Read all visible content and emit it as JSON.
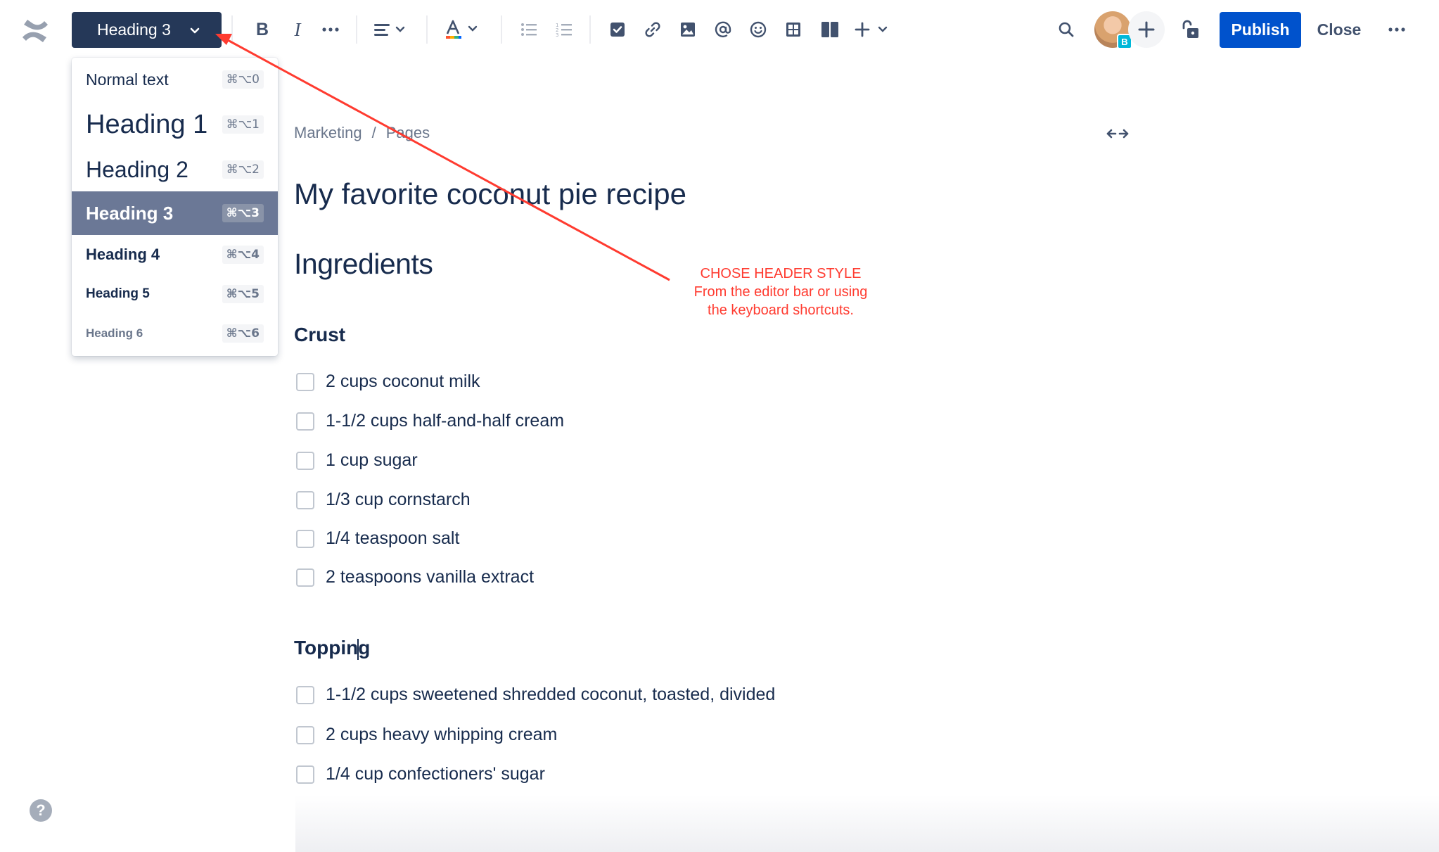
{
  "toolbar": {
    "text_style_label": "Heading 3",
    "publish_label": "Publish",
    "close_label": "Close",
    "avatar_badge": "B",
    "icons": [
      "confluence-logo-icon",
      "bold-icon",
      "italic-icon",
      "more-formatting-icon",
      "align-icon",
      "text-color-icon",
      "bullet-list-icon",
      "numbered-list-icon",
      "action-item-icon",
      "link-icon",
      "image-icon",
      "mention-icon",
      "emoji-icon",
      "table-icon",
      "layouts-icon",
      "insert-icon",
      "search-icon",
      "restrictions-icon",
      "more-icon"
    ]
  },
  "dropdown": {
    "items": [
      {
        "label": "Normal text",
        "shortcut": "⌘⌥0"
      },
      {
        "label": "Heading 1",
        "shortcut": "⌘⌥1"
      },
      {
        "label": "Heading 2",
        "shortcut": "⌘⌥2"
      },
      {
        "label": "Heading 3",
        "shortcut": "⌘⌥3"
      },
      {
        "label": "Heading 4",
        "shortcut": "⌘⌥4"
      },
      {
        "label": "Heading 5",
        "shortcut": "⌘⌥5"
      },
      {
        "label": "Heading 6",
        "shortcut": "⌘⌥6"
      }
    ],
    "selected": "Heading 3"
  },
  "page": {
    "breadcrumb": [
      "Marketing",
      "Pages"
    ],
    "title": "My favorite coconut pie recipe",
    "section_heading": "Ingredients",
    "crust_heading": "Crust",
    "crust_items": [
      "2 cups coconut milk",
      "1-1/2 cups half-and-half cream",
      "1 cup sugar",
      "1/3 cup cornstarch",
      "1/4 teaspoon salt",
      "2 teaspoons vanilla extract"
    ],
    "topping_heading_before_cursor": "Toppin",
    "topping_heading_after_cursor": "g",
    "topping_items": [
      "1-1/2 cups sweetened shredded coconut, toasted, divided",
      "2 cups heavy whipping cream",
      "1/4 cup confectioners' sugar"
    ]
  },
  "annotation": {
    "line1": "CHOSE HEADER STYLE",
    "line2": "From the editor bar or using",
    "line3": "the keyboard shortcuts.",
    "color": "#ff3b30"
  },
  "colors": {
    "primary": "#0052cc",
    "text_style_button": "#253858",
    "selected_item": "#6b7896",
    "text": "#172b4d",
    "muted": "#6b778c"
  },
  "help_label": "?"
}
